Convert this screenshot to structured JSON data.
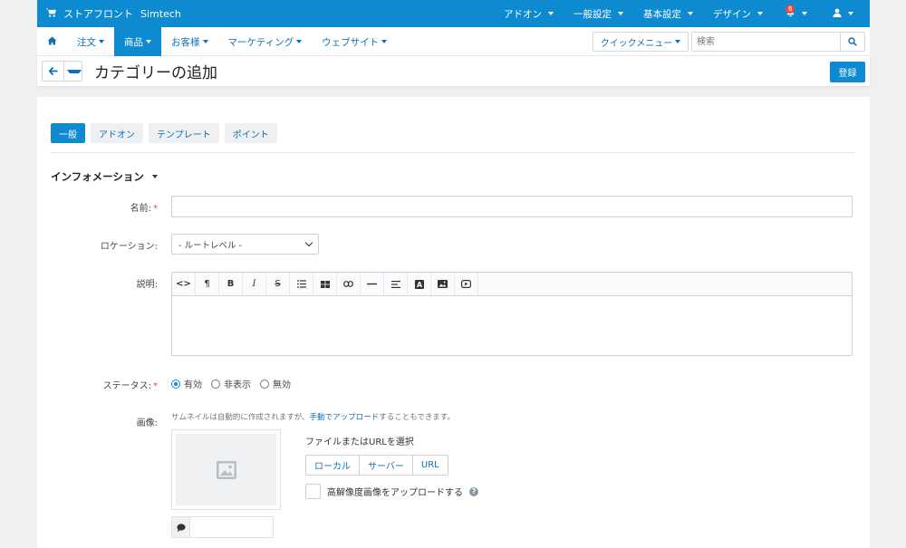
{
  "topbar": {
    "store_name": "ストアフロント",
    "vendor": "Simtech",
    "menu": [
      {
        "label": "アドオン"
      },
      {
        "label": "一般設定"
      },
      {
        "label": "基本設定"
      },
      {
        "label": "デザイン"
      }
    ],
    "notification_count": "6"
  },
  "nav": {
    "items": [
      {
        "label": "注文"
      },
      {
        "label": "商品"
      },
      {
        "label": "お客様"
      },
      {
        "label": "マーケティング"
      },
      {
        "label": "ウェブサイト"
      }
    ],
    "quick_menu": "クイックメニュー",
    "search_placeholder": "検索"
  },
  "page": {
    "title": "カテゴリーの追加",
    "save_label": "登録"
  },
  "tabs": [
    {
      "label": "一般"
    },
    {
      "label": "アドオン"
    },
    {
      "label": "テンプレート"
    },
    {
      "label": "ポイント"
    }
  ],
  "form": {
    "section_title": "インフォメーション",
    "name_label": "名前:",
    "name_value": "",
    "location_label": "ロケーション:",
    "location_value": "- ルートレベル -",
    "description_label": "説明:",
    "status_label": "ステータス:",
    "status_options": [
      {
        "label": "有効",
        "checked": true
      },
      {
        "label": "非表示",
        "checked": false
      },
      {
        "label": "無効",
        "checked": false
      }
    ],
    "image_label": "画像:",
    "image_hint_before": "サムネイルは自動的に作成されますが、",
    "image_hint_link": "手動でアップロード",
    "image_hint_after": "することもできます。",
    "file_select_label": "ファイルまたはURLを選択",
    "file_buttons": [
      {
        "label": "ローカル"
      },
      {
        "label": "サーバー"
      },
      {
        "label": "URL"
      }
    ],
    "hires_label": "高解像度画像をアップロードする"
  },
  "colors": {
    "primary": "#0d8ad0",
    "link": "#0d6fb8",
    "required": "#e74c3c"
  }
}
